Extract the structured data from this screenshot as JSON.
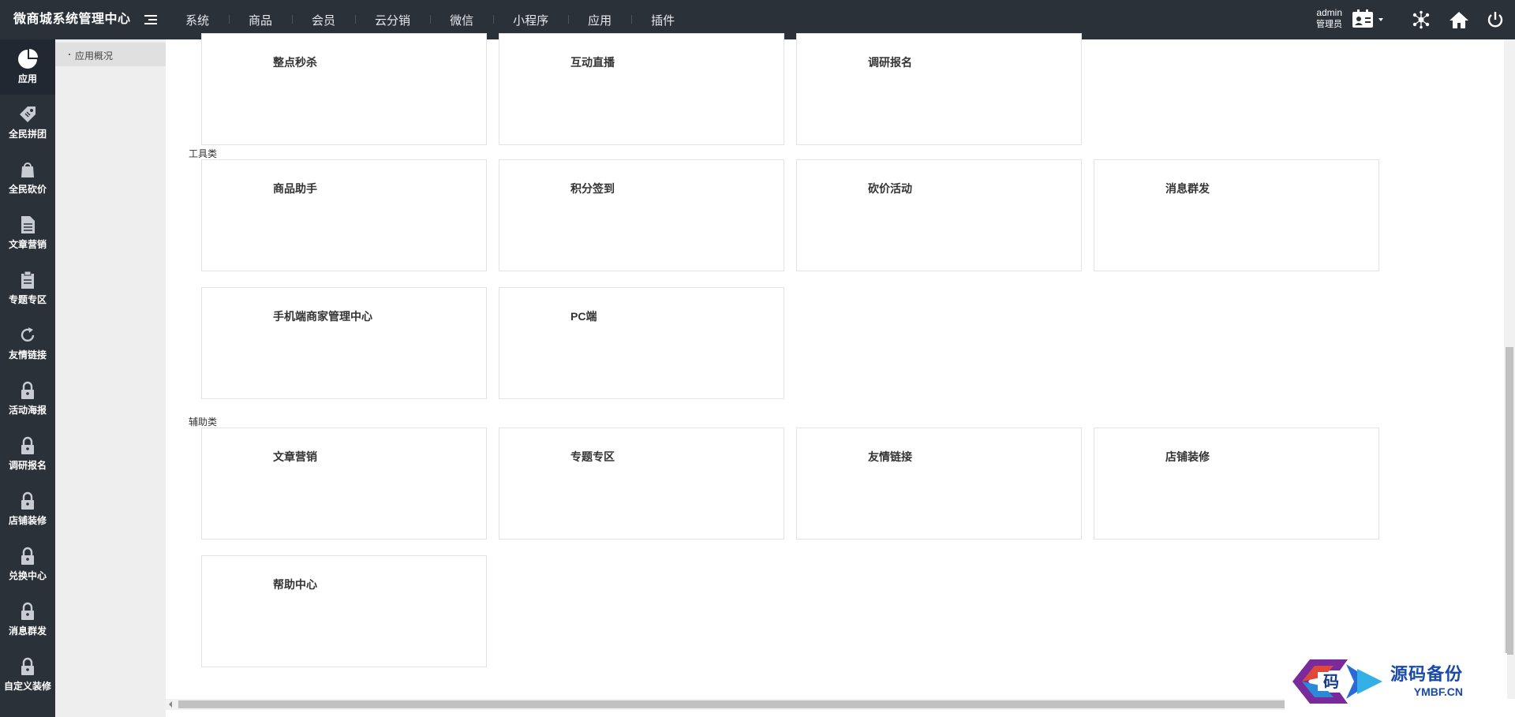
{
  "header": {
    "brand": "微商城系统管理中心",
    "nav": [
      "系统",
      "商品",
      "会员",
      "云分销",
      "微信",
      "小程序",
      "应用",
      "插件"
    ],
    "user_name": "admin",
    "user_role": "管理员"
  },
  "sidebar": {
    "items": [
      {
        "label": "应用",
        "icon": "pie-chart-icon"
      },
      {
        "label": "全民拼团",
        "icon": "tag-icon"
      },
      {
        "label": "全民砍价",
        "icon": "bag-icon"
      },
      {
        "label": "文章营销",
        "icon": "document-icon"
      },
      {
        "label": "专题专区",
        "icon": "clipboard-icon"
      },
      {
        "label": "友情链接",
        "icon": "refresh-icon"
      },
      {
        "label": "活动海报",
        "icon": "lock-icon"
      },
      {
        "label": "调研报名",
        "icon": "lock-icon"
      },
      {
        "label": "店铺装修",
        "icon": "lock-icon"
      },
      {
        "label": "兑换中心",
        "icon": "lock-icon"
      },
      {
        "label": "消息群发",
        "icon": "lock-icon"
      },
      {
        "label": "自定义装修",
        "icon": "lock-icon"
      }
    ]
  },
  "submenu": {
    "active_label": "应用概况"
  },
  "main": {
    "row0": [
      "整点秒杀",
      "互动直播",
      "调研报名"
    ],
    "tools_label": "工具类",
    "tools": [
      "商品助手",
      "积分签到",
      "砍价活动",
      "消息群发",
      "手机端商家管理中心",
      "PC端"
    ],
    "aux_label": "辅助类",
    "aux": [
      "文章营销",
      "专题专区",
      "友情链接",
      "店铺装修",
      "帮助中心"
    ]
  },
  "watermark": {
    "title": "源码备份",
    "subtitle": "YMBF.CN",
    "logo_char": "码"
  }
}
